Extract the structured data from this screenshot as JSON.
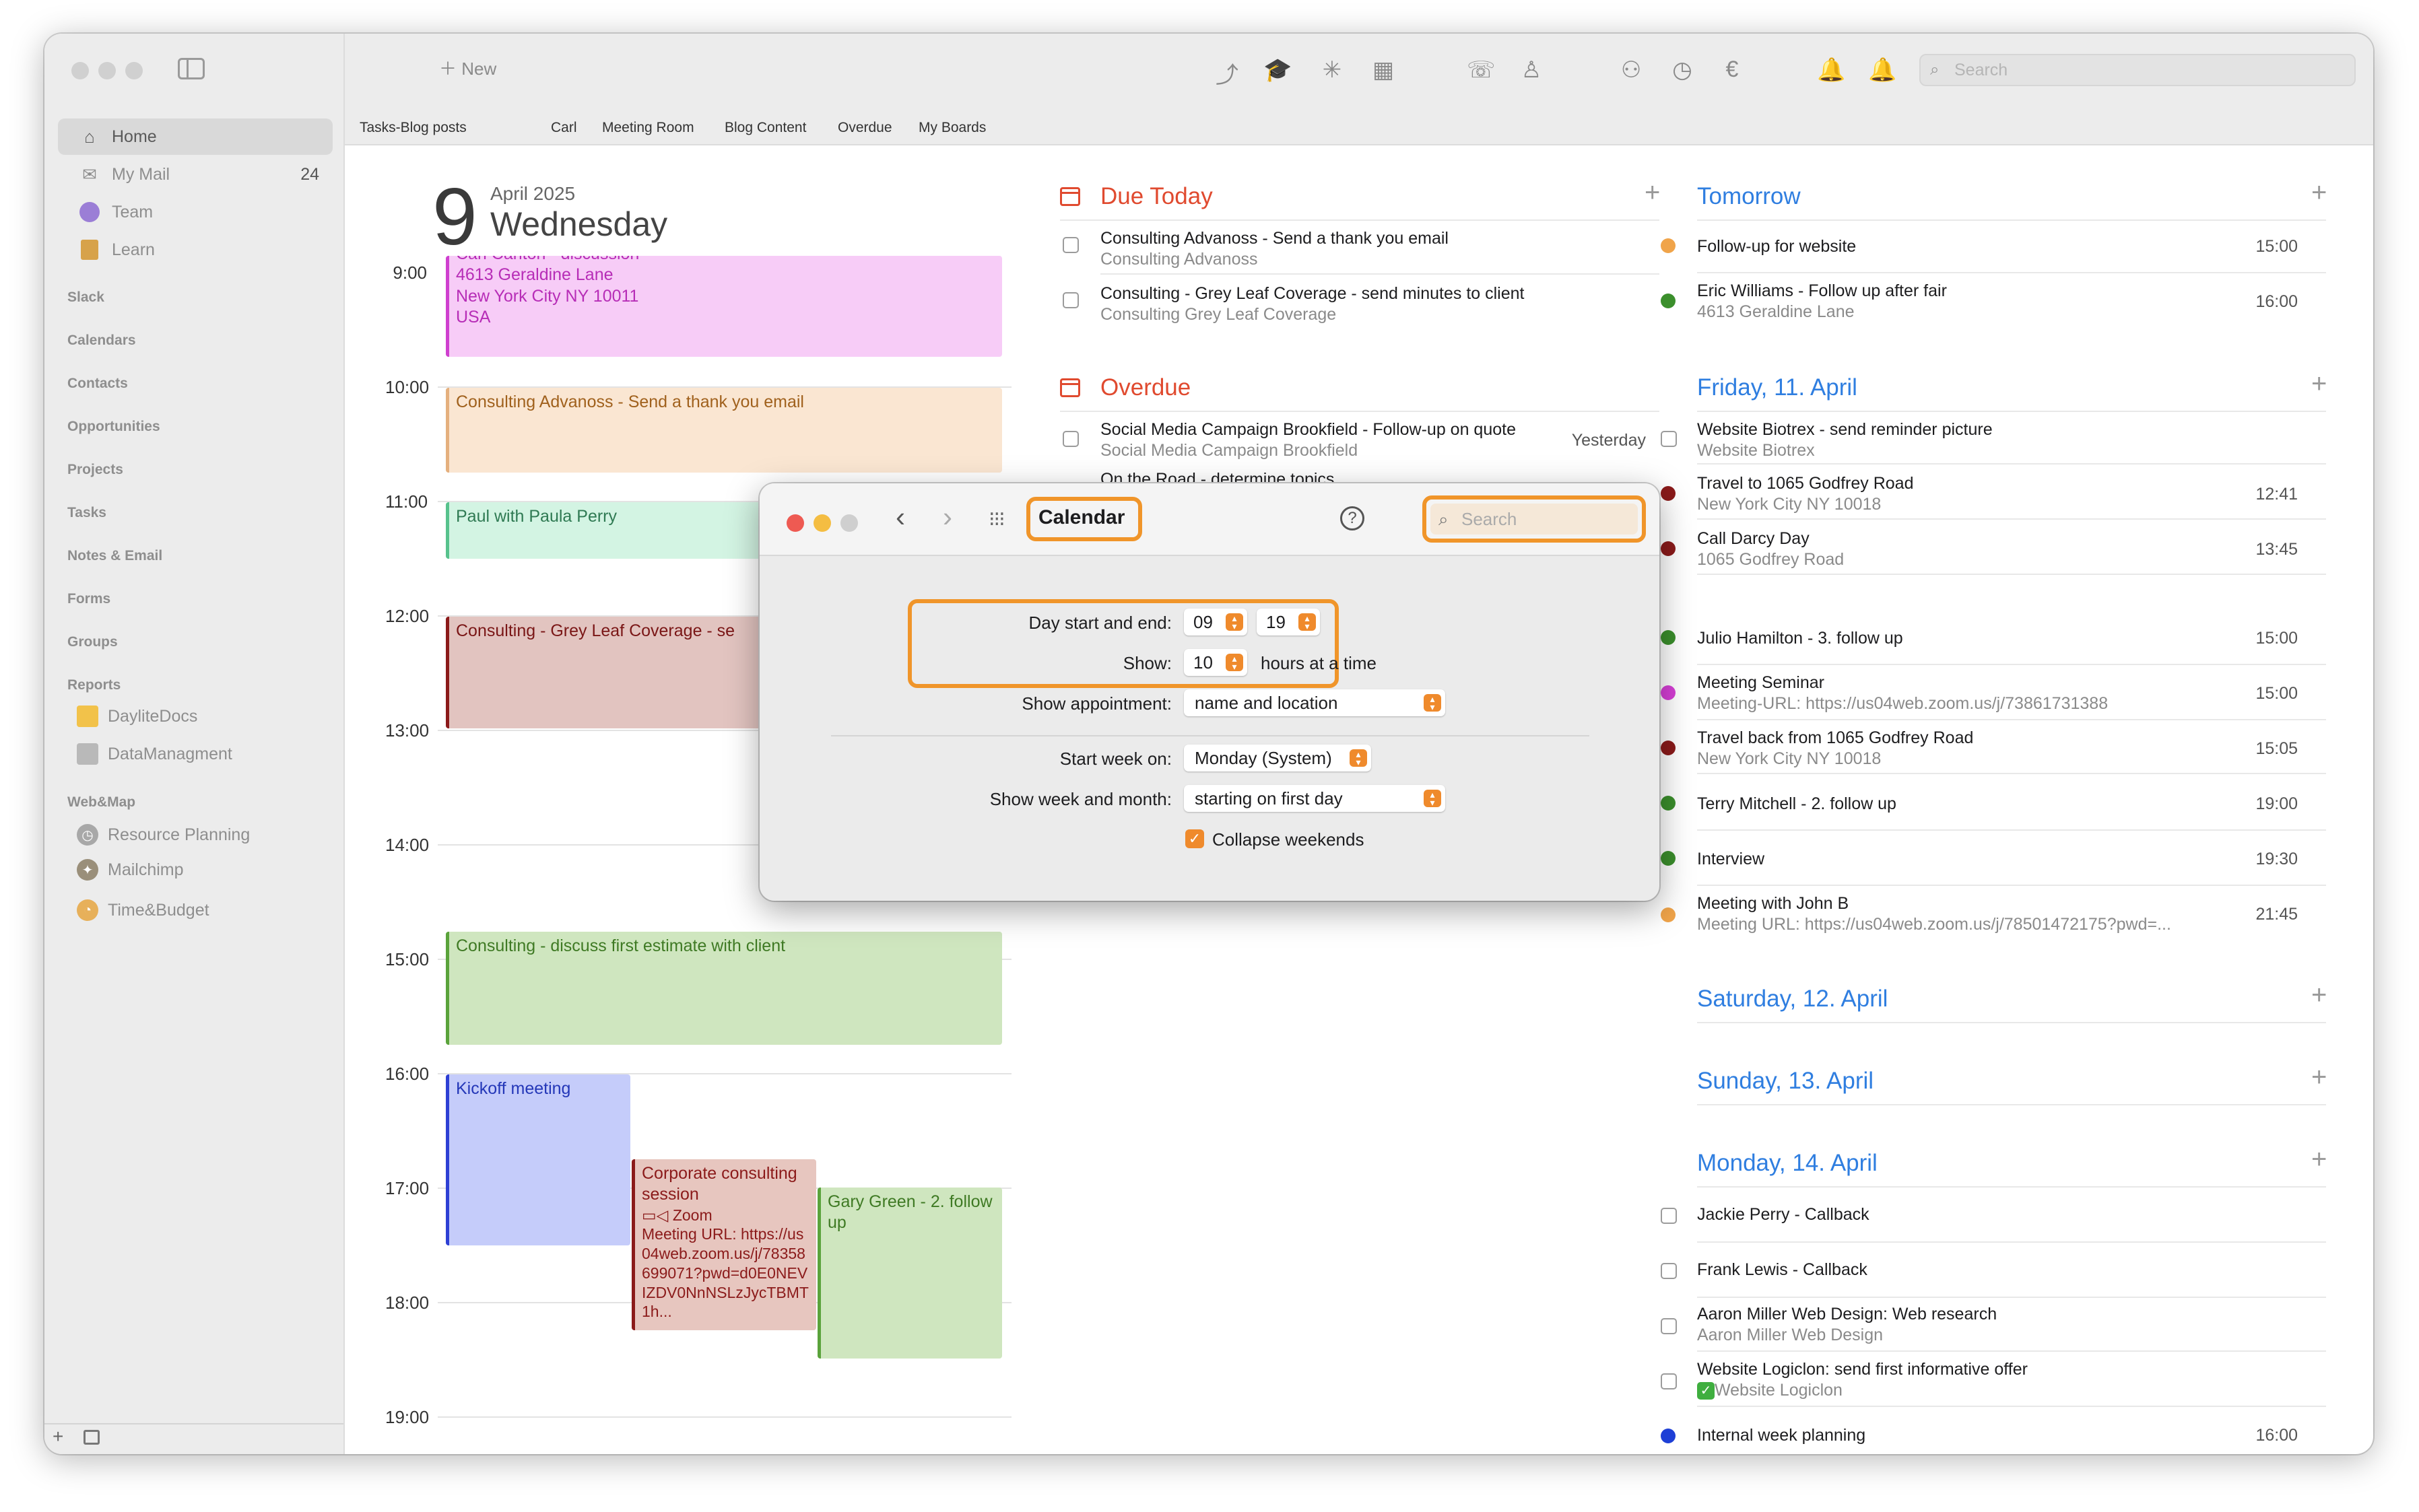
{
  "toolbar": {
    "new_label": "New",
    "search_placeholder": "Search"
  },
  "tabs": [
    "Tasks-Blog posts",
    "Carl",
    "Meeting Room",
    "Blog Content",
    "Overdue",
    "My Boards"
  ],
  "sidebar": {
    "items": [
      {
        "label": "Home",
        "icon": "house-icon"
      },
      {
        "label": "My Mail",
        "count": "24",
        "icon": "envelope-icon"
      },
      {
        "label": "Team",
        "icon": "team-icon"
      },
      {
        "label": "Learn",
        "icon": "learn-icon"
      }
    ],
    "sections": [
      "Slack",
      "Calendars",
      "Contacts",
      "Opportunities",
      "Projects",
      "Tasks",
      "Notes & Email",
      "Forms",
      "Groups",
      "Reports"
    ],
    "reports": [
      "DayliteDocs",
      "DataManagment"
    ],
    "webmap_header": "Web&Map",
    "webmap": [
      "Resource Planning",
      "Mailchimp",
      "Time&Budget"
    ]
  },
  "day": {
    "number": "9",
    "month_year": "April 2025",
    "weekday": "Wednesday"
  },
  "hours": [
    "9:00",
    "10:00",
    "11:00",
    "12:00",
    "13:00",
    "14:00",
    "15:00",
    "16:00",
    "17:00",
    "18:00",
    "19:00"
  ],
  "events": {
    "carl": {
      "l1": "Carl Carlton - discussion",
      "l2": "4613 Geraldine Lane",
      "l3": "New York City  NY 10011",
      "l4": "USA"
    },
    "advanos": "Consulting Advanoss - Send a thank you email",
    "paul": "Paul with Paula Perry",
    "greyleaf": "Consulting - Grey Leaf Coverage - se",
    "estimate": "Consulting - discuss first estimate with client",
    "kickoff": "Kickoff meeting",
    "corporate": {
      "title": "Corporate consulting session",
      "zoom": "Zoom",
      "url": "Meeting URL: https://us04web.zoom.us/j/78358699071?pwd=d0E0NEVIZDV0NnNSLzJycTBMT1h..."
    },
    "gary": "Gary Green - 2. follow up"
  },
  "due_today": {
    "title": "Due Today",
    "tasks": [
      {
        "t1": "Consulting Advanoss - Send a thank you email",
        "t2": "Consulting Advanoss"
      },
      {
        "t1": "Consulting - Grey Leaf Coverage - send minutes to client",
        "t2": "Consulting Grey Leaf Coverage"
      }
    ]
  },
  "overdue": {
    "title": "Overdue",
    "tasks": [
      {
        "t1": "Social Media Campaign Brookfield - Follow-up on quote",
        "t2": "Social Media Campaign Brookfield",
        "time": "Yesterday"
      },
      {
        "t1": "On the Road - determine topics"
      }
    ]
  },
  "right": {
    "tomorrow": "Tomorrow",
    "tomorrow_items": [
      {
        "t1": "Follow-up for website",
        "time": "15:00",
        "color": "#f0a44a"
      },
      {
        "t1": "Eric Williams - Follow up after fair",
        "t2": "4613 Geraldine Lane",
        "time": "16:00",
        "color": "#3b8f2c"
      }
    ],
    "friday": "Friday, 11. April",
    "friday_items": [
      {
        "t1": "Website Biotrex - send reminder picture",
        "t2": "Website Biotrex"
      },
      {
        "t1": "Travel to 1065 Godfrey Road",
        "t2": "New York City  NY 10018",
        "time": "12:41",
        "color": "#8b1a1a"
      },
      {
        "t1": "Call Darcy Day",
        "t2": "1065 Godfrey Road",
        "time": "13:45",
        "color": "#8b1a1a"
      },
      {
        "t1": "Julio Hamilton - 3. follow up",
        "time": "15:00",
        "color": "#3b8f2c"
      },
      {
        "t1": "Meeting Seminar",
        "t2": "Meeting-URL: https://us04web.zoom.us/j/73861731388",
        "time": "15:00",
        "color": "#d63fd6"
      },
      {
        "t1": "Travel back from 1065 Godfrey Road",
        "t2": "New York City  NY 10018",
        "time": "15:05",
        "color": "#8b1a1a"
      },
      {
        "t1": "Terry Mitchell - 2. follow up",
        "time": "19:00",
        "color": "#3b8f2c"
      },
      {
        "t1": "Interview",
        "time": "19:30",
        "color": "#3b8f2c"
      },
      {
        "t1": "Meeting with John B",
        "t2": "Meeting URL: https://us04web.zoom.us/j/78501472175?pwd=...",
        "time": "21:45",
        "color": "#f0a44a"
      }
    ],
    "saturday": "Saturday, 12. April",
    "sunday": "Sunday, 13. April",
    "monday": "Monday, 14. April",
    "monday_items": [
      {
        "t1": "Jackie Perry - Callback"
      },
      {
        "t1": "Frank Lewis - Callback"
      },
      {
        "t1": "Aaron Miller Web Design: Web research",
        "t2": "Aaron Miller Web Design"
      },
      {
        "t1": "Website Logiclon: send first informative offer",
        "t2": "Website Logiclon"
      },
      {
        "t1": "Internal week planning",
        "time": "16:00",
        "color": "#1e3fd6"
      }
    ]
  },
  "modal": {
    "title": "Calendar",
    "search_placeholder": "Search",
    "day_start_label": "Day start and end:",
    "day_start": "09",
    "day_end": "19",
    "show_label": "Show:",
    "show_hours": "10",
    "hours_suffix": "hours at a time",
    "show_appt_label": "Show appointment:",
    "show_appt": "name and location",
    "start_week_label": "Start week on:",
    "start_week": "Monday (System)",
    "week_month_label": "Show week and month:",
    "week_month": "starting on first day",
    "collapse_label": "Collapse weekends"
  }
}
